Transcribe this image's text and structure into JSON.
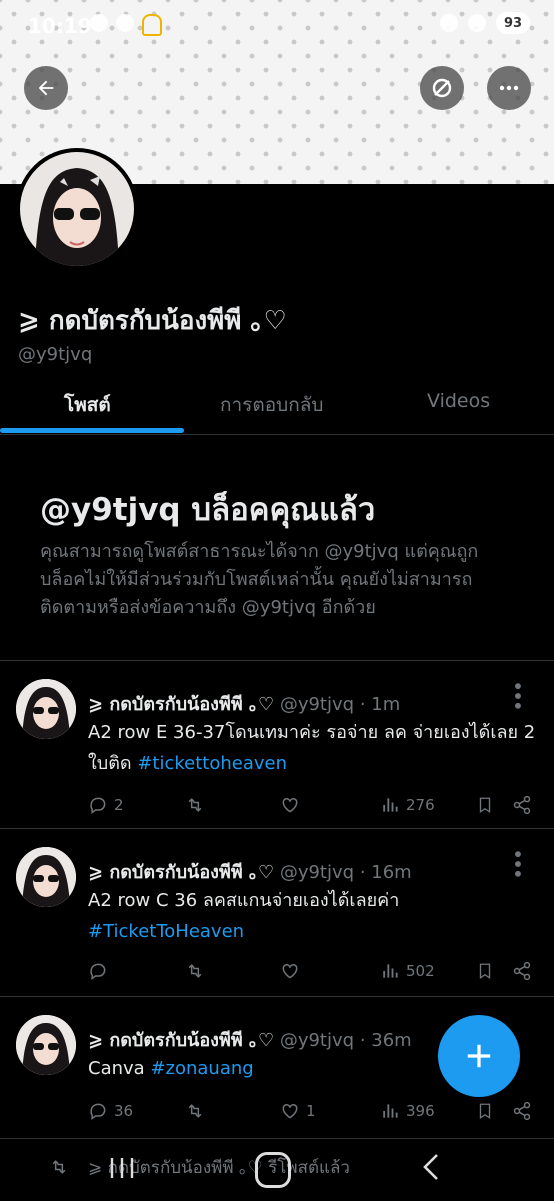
{
  "status_bar": {
    "time": "10:19",
    "battery": "93"
  },
  "profile": {
    "name": "⩾ กดบัตรกับน้องพีพี ｡♡",
    "handle": "@y9tjvq"
  },
  "tabs": [
    {
      "label": "โพสต์",
      "active": true
    },
    {
      "label": "การตอบกลับ",
      "active": false
    },
    {
      "label": "Videos",
      "active": false
    }
  ],
  "blocked": {
    "title": "@y9tjvq บล็อคคุณแล้ว",
    "text": "คุณสามารถดูโพสต์สาธารณะได้จาก @y9tjvq แต่คุณถูกบล็อคไม่ให้มีส่วนร่วมกับโพสต์เหล่านั้น คุณยังไม่สามารถติดตามหรือส่งข้อความถึง @y9tjvq อีกด้วย"
  },
  "posts": [
    {
      "name": "⩾ กดบัตรกับน้องพีพี ｡♡",
      "handle": "@y9tjvq",
      "time": "1m",
      "text": "A2 row E 36-37โดนเทมาค่ะ รอจ่าย ลค จ่ายเองได้เลย 2 ใบติด",
      "hashtag": "#tickettoheaven",
      "replies": "2",
      "reposts": "",
      "likes": "",
      "views": "276"
    },
    {
      "name": "⩾ กดบัตรกับน้องพีพี ｡♡",
      "handle": "@y9tjvq",
      "time": "16m",
      "text": "A2 row C 36 ลคสแกนจ่ายเองได้เลยค่า",
      "hashtag": "#TicketToHeaven",
      "replies": "",
      "reposts": "",
      "likes": "",
      "views": "502"
    },
    {
      "name": "⩾ กดบัตรกับน้องพีพี ｡♡",
      "handle": "@y9tjvq",
      "time": "36m",
      "text": "Canva",
      "hashtag": "#zonauang",
      "replies": "36",
      "reposts": "",
      "likes": "1",
      "views": "396"
    }
  ],
  "repost_notice": "⩾ กดบัตรกับน้องพีพี ｡♡ รีโพสต์แล้ว",
  "colors": {
    "accent": "#1d9bf0",
    "background": "#000000",
    "muted": "#71767b"
  },
  "icons": [
    "back-arrow-icon",
    "grok-icon",
    "more-icon",
    "reply-icon",
    "repost-icon",
    "like-icon",
    "views-icon",
    "bookmark-icon",
    "share-icon",
    "plus-icon"
  ]
}
